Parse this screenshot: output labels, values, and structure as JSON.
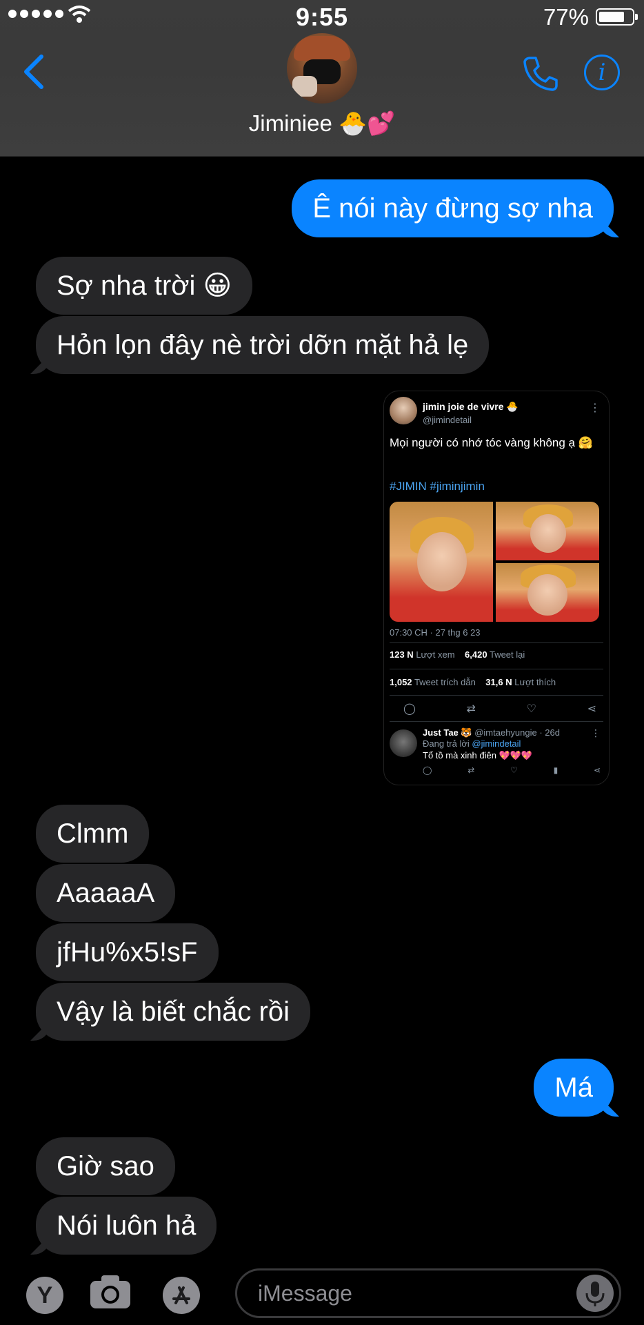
{
  "status_bar": {
    "time": "9:55",
    "battery_percent": "77%",
    "battery_level": 0.77
  },
  "header": {
    "contact_name": "Jiminiee 🐣💕",
    "accent_color": "#0a84ff"
  },
  "messages": [
    {
      "dir": "out",
      "text": "Ê nói này đừng sợ nha"
    },
    {
      "dir": "in",
      "text": "Sợ nha trời 😀"
    },
    {
      "dir": "in",
      "text": "Hỏn lọn đây nè trời dỡn mặt hả lẹ"
    },
    {
      "dir": "in",
      "text": "Clmm"
    },
    {
      "dir": "in",
      "text": "AaaaaA"
    },
    {
      "dir": "in",
      "text": "jfHu%x5!sF"
    },
    {
      "dir": "in",
      "text": "Vậy là biết chắc rồi"
    },
    {
      "dir": "out",
      "text": "Má"
    },
    {
      "dir": "in",
      "text": "Giờ sao"
    },
    {
      "dir": "in",
      "text": "Nói luôn hả"
    }
  ],
  "tweet": {
    "author_name": "jimin joie de vivre 🐣",
    "author_handle": "@jimindetail",
    "text": "Mọi người có nhớ tóc vàng không ạ 🤗",
    "hashtags": "#JIMIN #jiminjimin",
    "datetime": "07:30 CH · 27 thg 6 23",
    "views_count": "123 N",
    "views_label": "Lượt xem",
    "retweets_count": "6,420",
    "retweets_label": "Tweet lại",
    "quotes_count": "1,052",
    "quotes_label": "Tweet trích dẫn",
    "likes_count": "31,6 N",
    "likes_label": "Lượt thích",
    "reply": {
      "name": "Just Tae 🐯",
      "handle": "@imtaehyungie · 26d",
      "replying_to_label": "Đang trả lời",
      "replying_to_handle": "@jimindetail",
      "text": "Tổ tồ mà xinh điên 💖💖💖"
    }
  },
  "input_bar": {
    "placeholder": "iMessage",
    "app_button_label": "Y"
  }
}
